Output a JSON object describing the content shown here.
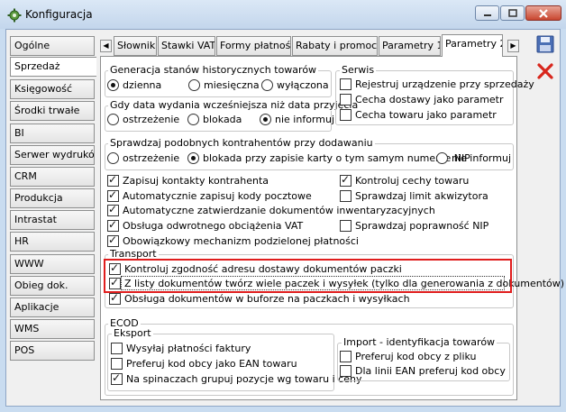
{
  "window": {
    "title": "Konfiguracja"
  },
  "left_tabs": [
    "Ogólne",
    "Sprzedaż",
    "Księgowość",
    "Środki trwałe",
    "BI",
    "Serwer wydruków",
    "CRM",
    "Produkcja",
    "Intrastat",
    "HR",
    "WWW",
    "Obieg dok.",
    "Aplikacje",
    "WMS",
    "POS"
  ],
  "left_tabs_active": "Sprzedaż",
  "top_tabs": [
    "Słowniki",
    "Stawki VAT",
    "Formy płatności",
    "Rabaty i promocje",
    "Parametry 1",
    "Parametry 2"
  ],
  "top_tabs_active": "Parametry 2",
  "sections": {
    "generacja": {
      "title": "Generacja stanów historycznych towarów",
      "options": [
        "dzienna",
        "miesięczna",
        "wyłączona"
      ],
      "selected": "dzienna"
    },
    "gdy_data": {
      "title": "Gdy data wydania wcześniejsza niż data przyjęcia",
      "options": [
        "ostrzeżenie",
        "blokada",
        "nie informuj"
      ],
      "selected": "nie informuj"
    },
    "serwis": {
      "title": "Serwis",
      "items": [
        {
          "label": "Rejestruj urządzenie przy sprzedaży",
          "checked": false
        },
        {
          "label": "Cecha dostawy jako parametr",
          "checked": false
        },
        {
          "label": "Cecha towaru jako parametr",
          "checked": false
        }
      ]
    },
    "kontrahenci": {
      "title": "Sprawdzaj podobnych kontrahentów przy dodawaniu",
      "options": [
        "ostrzeżenie",
        "blokada przy zapisie karty o tym samym numerze NIP",
        "nie informuj"
      ],
      "selected": "blokada przy zapisie karty o tym samym numerze NIP"
    },
    "opcje_lewe": [
      {
        "label": "Zapisuj kontakty kontrahenta",
        "checked": true
      },
      {
        "label": "Automatycznie zapisuj kody pocztowe",
        "checked": true
      },
      {
        "label": "Automatyczne zatwierdzanie dokumentów inwentaryzacyjnych",
        "checked": true
      },
      {
        "label": "Obsługa odwrotnego obciążenia VAT",
        "checked": true
      },
      {
        "label": "Obowiązkowy mechanizm podzielonej płatności",
        "checked": true
      }
    ],
    "opcje_prawe": [
      {
        "label": "Kontroluj cechy towaru",
        "checked": true
      },
      {
        "label": "Sprawdzaj limit akwizytora",
        "checked": false
      },
      {
        "label": "Sprawdzaj poprawność NIP",
        "checked": false
      }
    ],
    "transport": {
      "title": "Transport",
      "items": [
        {
          "label": "Kontroluj zgodność adresu dostawy dokumentów paczki",
          "checked": true
        },
        {
          "label": "Z listy dokumentów twórz wiele paczek i wysyłek (tylko dla generowania z dokumentów)",
          "checked": true
        },
        {
          "label": "Obsługa dokumentów w buforze na paczkach i wysyłkach",
          "checked": true
        }
      ]
    },
    "ecod": {
      "title": "ECOD",
      "eksport": {
        "title": "Eksport",
        "items": [
          {
            "label": "Wysyłaj płatności faktury",
            "checked": false
          },
          {
            "label": "Preferuj kod obcy jako EAN towaru",
            "checked": false
          },
          {
            "label": "Na spinaczach grupuj pozycje wg towaru i ceny",
            "checked": true
          }
        ]
      },
      "import": {
        "title": "Import - identyfikacja towarów",
        "items": [
          {
            "label": "Preferuj kod obcy z pliku",
            "checked": false
          },
          {
            "label": "Dla linii EAN preferuj kod obcy",
            "checked": false
          }
        ]
      }
    }
  },
  "toolbar": {
    "save_icon": "floppy-disk-icon",
    "cancel_icon": "red-x-icon"
  },
  "colors": {
    "highlight": "#e01d1d",
    "window_frame": "#c9dcf0"
  }
}
